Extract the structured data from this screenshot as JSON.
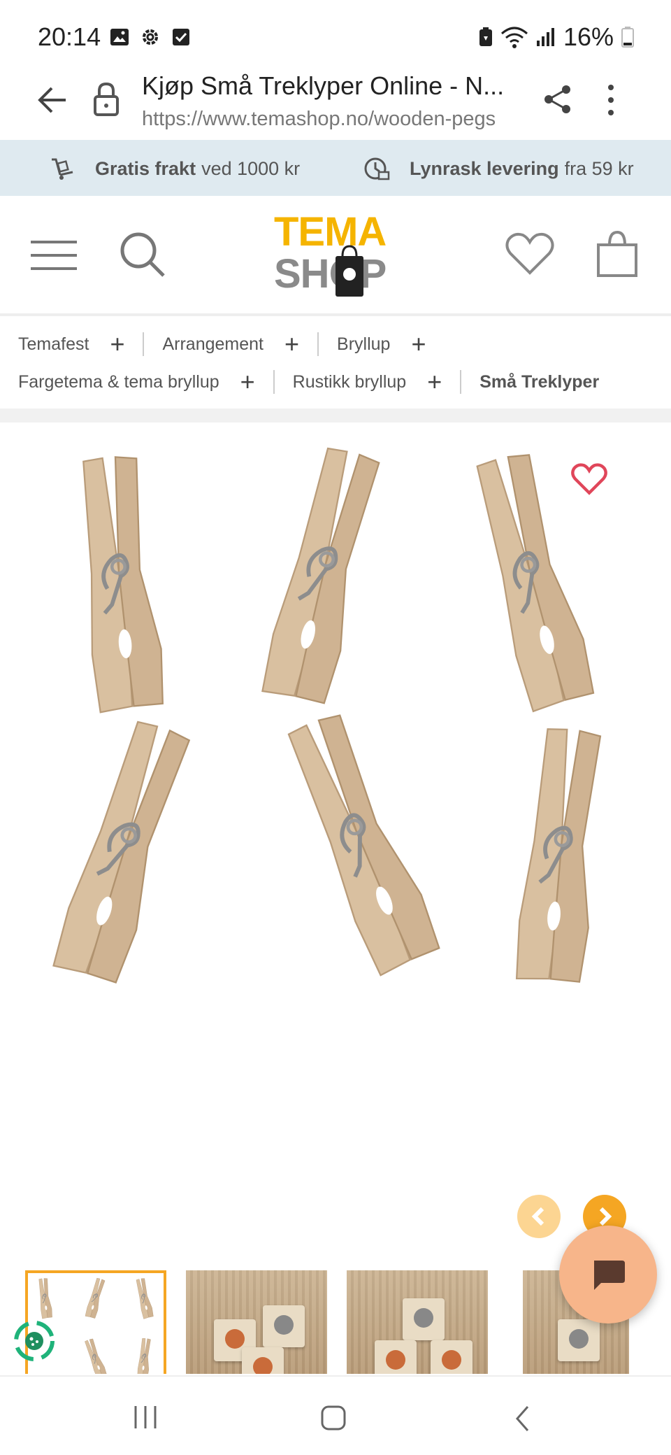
{
  "status_bar": {
    "time": "20:14",
    "battery": "16%",
    "icons_left": [
      "image-icon",
      "gear-icon",
      "checkbox-icon"
    ],
    "icons_right": [
      "battery-saver-icon",
      "wifi-icon",
      "signal-icon",
      "battery-icon"
    ]
  },
  "browser": {
    "title": "Kjøp Små Treklyper Online - N...",
    "url": "https://www.temashop.no/wooden-pegs"
  },
  "promo": {
    "shipping_bold": "Gratis frakt",
    "shipping_text": "ved 1000 kr",
    "delivery_bold": "Lynrask levering",
    "delivery_text": "fra 59 kr"
  },
  "logo": {
    "top": "TEMA",
    "bottom": "SHOP",
    "colors": {
      "top": "#f5b400",
      "bottom": "#8a8a8a"
    }
  },
  "breadcrumbs": {
    "row1": [
      "Temafest",
      "Arrangement",
      "Bryllup"
    ],
    "row2": [
      "Fargetema & tema bryllup",
      "Rustikk bryllup"
    ],
    "current": "Små Treklyper",
    "expand_symbol": "+"
  },
  "colors": {
    "accent": "#f5a623",
    "promo_bg": "#dfeaf0",
    "favorite": "#e0465a"
  }
}
